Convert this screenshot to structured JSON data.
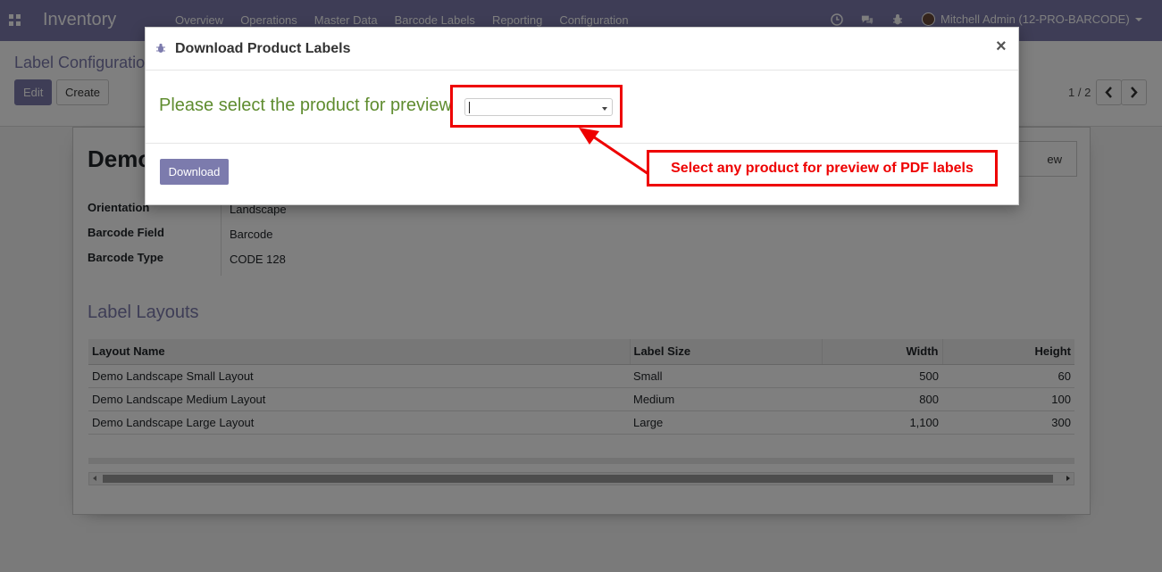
{
  "navbar": {
    "app_name": "Inventory",
    "menu": [
      "Overview",
      "Operations",
      "Master Data",
      "Barcode Labels",
      "Reporting",
      "Configuration"
    ],
    "user": "Mitchell Admin (12-PRO-BARCODE)",
    "icons": [
      "apps-icon",
      "clock-icon",
      "chat-icon",
      "bug-icon",
      "user-avatar"
    ]
  },
  "control": {
    "breadcrumb": "Label Configuration",
    "edit_label": "Edit",
    "create_label": "Create",
    "pager": "1 / 2"
  },
  "form": {
    "title": "Demo",
    "preview_button": "ew",
    "fields": [
      {
        "label": "Orientation",
        "value": "Landscape"
      },
      {
        "label": "Barcode Field",
        "value": "Barcode"
      },
      {
        "label": "Barcode Type",
        "value": "CODE 128"
      }
    ],
    "section_title": "Label Layouts",
    "table": {
      "headers": [
        "Layout Name",
        "Label Size",
        "Width",
        "Height"
      ],
      "rows": [
        [
          "Demo Landscape Small Layout",
          "Small",
          "500",
          "60"
        ],
        [
          "Demo Landscape Medium Layout",
          "Medium",
          "800",
          "100"
        ],
        [
          "Demo Landscape Large Layout",
          "Large",
          "1,100",
          "300"
        ]
      ]
    }
  },
  "modal": {
    "title": "Download Product Labels",
    "prompt": "Please select the product for preview",
    "select_value": "",
    "download_label": "Download",
    "close_glyph": "×"
  },
  "annotation": {
    "callout_text": "Select any product for preview of PDF labels",
    "color": "#e00000"
  },
  "colors": {
    "brand": "#7c7bad",
    "prompt": "#5f8c2f"
  }
}
